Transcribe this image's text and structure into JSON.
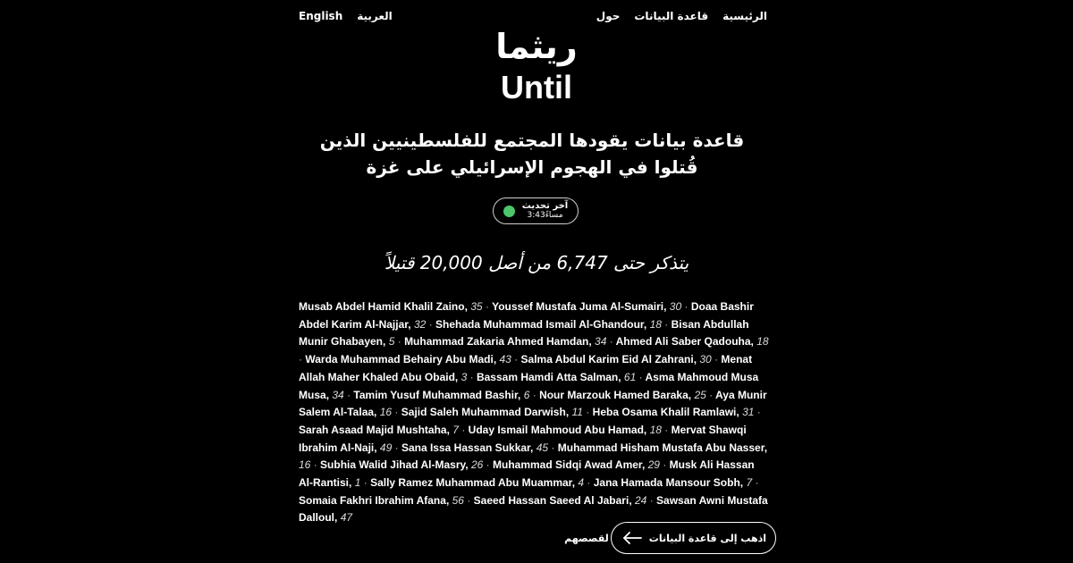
{
  "nav": {
    "right_links": [
      "الرئيسية",
      "قاعدة البيانات",
      "حول"
    ],
    "left_links": [
      "العربية",
      "English"
    ]
  },
  "brand": {
    "arabic": "ريثما",
    "english": "Until"
  },
  "tagline": "قاعدة بيانات يقودها المجتمع للفلسطينيين الذين قُتلوا في الهجوم الإسرائيلي على غزة",
  "update": {
    "label": "آخر تحديث",
    "time": "مساءً3:43",
    "status_color": "#4cc76a"
  },
  "remember_line": "يتذكر حتى 6,747 من أصل 20,000 قتيلاً",
  "victims": [
    {
      "name": "Musab Abdel Hamid Khalil Zaino",
      "age": "35"
    },
    {
      "name": "Youssef Mustafa Juma Al-Sumairi",
      "age": "30"
    },
    {
      "name": "Doaa Bashir Abdel Karim Al-Najjar",
      "age": "32"
    },
    {
      "name": "Shehada Muhammad Ismail Al-Ghandour",
      "age": "18"
    },
    {
      "name": "Bisan Abdullah Munir Ghabayen",
      "age": "5"
    },
    {
      "name": "Muhammad Zakaria Ahmed Hamdan",
      "age": "34"
    },
    {
      "name": "Ahmed Ali Saber Qadouha",
      "age": "18"
    },
    {
      "name": "Warda Muhammad Behairy Abu Madi",
      "age": "43"
    },
    {
      "name": "Salma Abdul Karim Eid Al Zahrani",
      "age": "30"
    },
    {
      "name": "Menat Allah Maher Khaled Abu Obaid",
      "age": "3"
    },
    {
      "name": "Bassam Hamdi Atta Salman",
      "age": "61"
    },
    {
      "name": "Asma Mahmoud Musa Musa",
      "age": "34"
    },
    {
      "name": "Tamim Yusuf Muhammad Bashir",
      "age": "6"
    },
    {
      "name": "Nour Marzouk Hamed Baraka",
      "age": "25"
    },
    {
      "name": "Aya Munir Salem Al-Talaa",
      "age": "16"
    },
    {
      "name": "Sajid Saleh Muhammad Darwish",
      "age": "11"
    },
    {
      "name": "Heba Osama Khalil Ramlawi",
      "age": "31"
    },
    {
      "name": "Sarah Asaad Majid Mushtaha",
      "age": "7"
    },
    {
      "name": "Uday Ismail Mahmoud Abu Hamad",
      "age": "18"
    },
    {
      "name": "Mervat Shawqi Ibrahim Al-Naji",
      "age": "49"
    },
    {
      "name": "Sana Issa Hassan Sukkar",
      "age": "45"
    },
    {
      "name": "Muhammad Hisham Mustafa Abu Nasser",
      "age": "16"
    },
    {
      "name": "Subhia Walid Jihad Al-Masry",
      "age": "26"
    },
    {
      "name": "Muhammad Sidqi Awad Amer",
      "age": "29"
    },
    {
      "name": "Musk Ali Hassan Al-Rantisi",
      "age": "1"
    },
    {
      "name": "Sally Ramez Muhammad Abu Muammar",
      "age": "4"
    },
    {
      "name": "Jana Hamada Mansour Sobh",
      "age": "7"
    },
    {
      "name": "Somaia Fakhri Ibrahim Afana",
      "age": "56"
    },
    {
      "name": "Saeed Hassan Saeed Al Jabari",
      "age": "24"
    },
    {
      "name": "Sawsan Awni Mustafa Dalloul",
      "age": "47"
    }
  ],
  "separator": "·",
  "cta": {
    "button_label": "اذهب إلى قاعدة البيانات",
    "secondary_label": "لقصصهم",
    "icon": "arrow-left-icon"
  }
}
